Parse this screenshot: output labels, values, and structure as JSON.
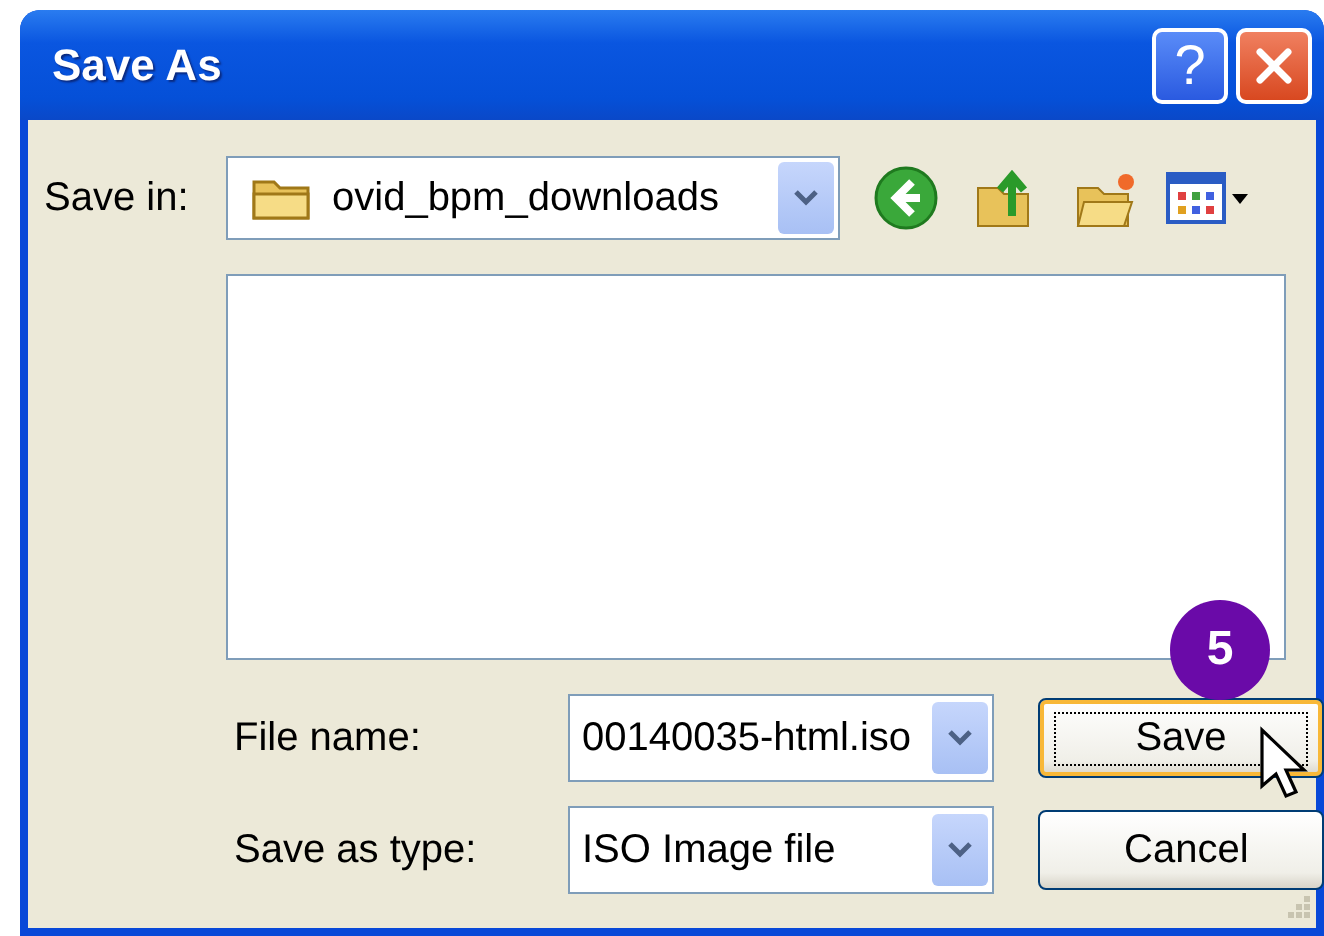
{
  "window": {
    "title": "Save As",
    "help_label": "?"
  },
  "save_in": {
    "label": "Save in:",
    "value": "ovid_bpm_downloads"
  },
  "step_badge": "5",
  "fields": [
    {
      "label": "File name:",
      "value": "00140035-html.iso"
    },
    {
      "label": "Save as type:",
      "value": "ISO Image file"
    }
  ],
  "buttons": [
    {
      "label": "Save",
      "focused": true
    },
    {
      "label": "Cancel",
      "focused": false
    }
  ]
}
